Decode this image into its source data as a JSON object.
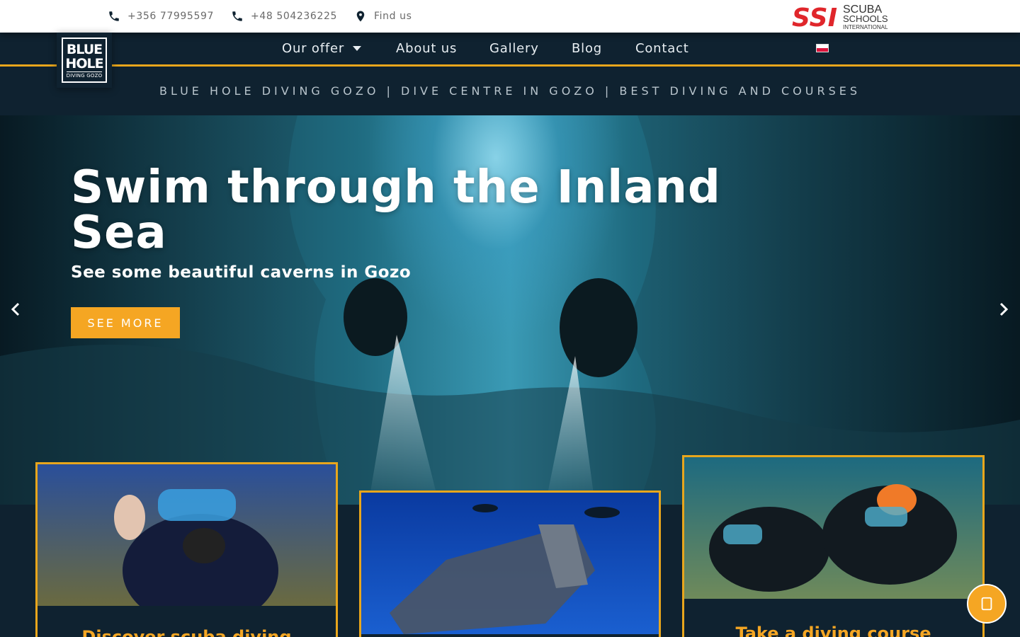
{
  "contacts": [
    {
      "icon": "phone-icon",
      "text": "+356 77995597"
    },
    {
      "icon": "phone-icon",
      "text": "+48 504236225"
    },
    {
      "icon": "map-pin-icon",
      "text": "Find us"
    }
  ],
  "partner_logo": {
    "line1": "SCUBA",
    "line2": "SCHOOLS",
    "line3": "INTERNATIONAL",
    "mark": "SSI"
  },
  "brand": {
    "big_line1": "BLUE",
    "big_line2": "HOLE",
    "small": "DIVING GOZO"
  },
  "nav": {
    "items": [
      "Our offer",
      "About us",
      "Gallery",
      "Blog",
      "Contact"
    ],
    "language_flag": "pl-flag-icon"
  },
  "tagline": "BLUE HOLE DIVING GOZO | DIVE CENTRE IN GOZO | BEST DIVING AND COURSES",
  "hero": {
    "title": "Swim through the Inland Sea",
    "subtitle": "See some beautiful caverns in Gozo",
    "button": "SEE MORE"
  },
  "cards": [
    {
      "title": "Discover scuba diving"
    },
    {
      "title": ""
    },
    {
      "title": "Take a diving course"
    }
  ],
  "colors": {
    "navy": "#0f2230",
    "accent": "#f5a623",
    "border": "#e8a61c"
  }
}
